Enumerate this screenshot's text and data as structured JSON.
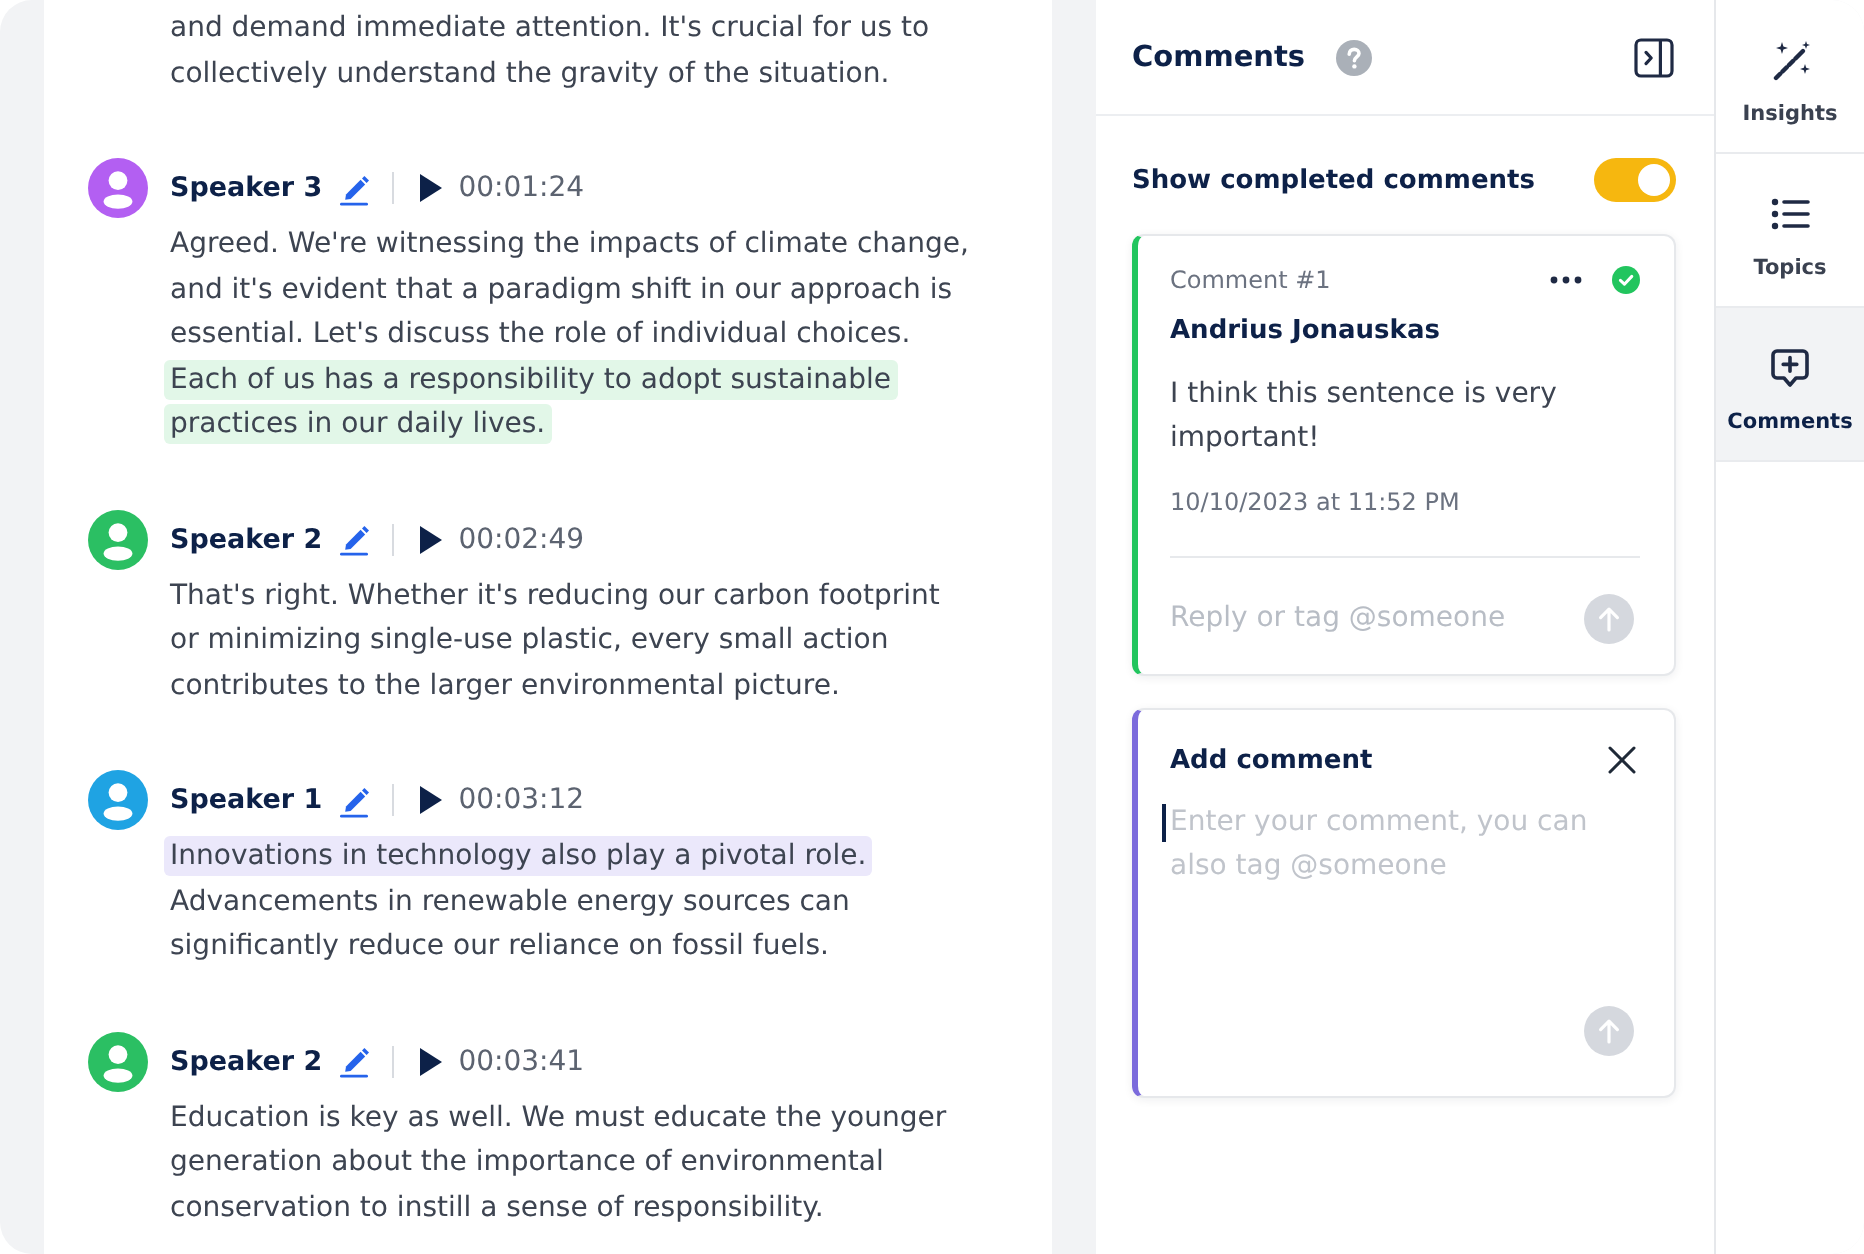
{
  "transcript": {
    "segments": [
      {
        "parts": [
          {
            "text": "and demand immediate attention. It's crucial for us to collectively understand the gravity of the situation.",
            "highlighted": false
          }
        ]
      },
      {
        "speaker": "Speaker 3",
        "color": "#b35ff2",
        "time": "00:01:24",
        "parts": [
          {
            "text": "Agreed. We're witnessing the impacts of climate change, and it's evident that a paradigm shift in our approach is essential. Let's discuss the role of individual choices.",
            "highlighted": false
          },
          {
            "text": "Each of us has a responsibility to adopt sustainable practices in our daily lives.",
            "highlighted": true,
            "color": "#e2f7e8"
          }
        ]
      },
      {
        "speaker": "Speaker 2",
        "color": "#2bbf63",
        "time": "00:02:49",
        "parts": [
          {
            "text": "That's right. Whether it's reducing our carbon footprint or minimizing single-use plastic, every small action contributes to the larger environmental picture.",
            "highlighted": false
          }
        ]
      },
      {
        "speaker": "Speaker 1",
        "color": "#1fa3e3",
        "time": "00:03:12",
        "parts": [
          {
            "text": "Innovations in technology also play a pivotal role.",
            "highlighted": true,
            "color": "#ebe8fb"
          },
          {
            "text": "Advancements in renewable energy sources can significantly reduce our reliance on fossil fuels.",
            "highlighted": false
          }
        ]
      },
      {
        "speaker": "Speaker 2",
        "color": "#2bbf63",
        "time": "00:03:41",
        "parts": [
          {
            "text": "Education is key as well. We must educate the younger generation about the importance of environmental conservation to instill a sense of responsibility.",
            "highlighted": false
          }
        ]
      }
    ]
  },
  "comments_panel": {
    "title": "Comments",
    "show_completed": {
      "label": "Show completed comments",
      "on": true
    },
    "comments": [
      {
        "number": "Comment #1",
        "author": "Andrius Jonauskas",
        "text": "I think this sentence is very important!",
        "date": "10/10/2023 at 11:52 PM",
        "resolved": true,
        "reply": {
          "placeholder": "Reply or tag @someone"
        }
      }
    ],
    "new_comment": {
      "title": "Add comment",
      "placeholder": "Enter your comment, you can also tag @someone",
      "focused": true
    }
  },
  "sidebar": {
    "tabs": [
      {
        "label": "Insights",
        "kind": "wand",
        "selected": false
      },
      {
        "label": "Topics",
        "kind": "list",
        "selected": false
      },
      {
        "label": "Comments",
        "kind": "comment",
        "selected": true
      }
    ]
  }
}
